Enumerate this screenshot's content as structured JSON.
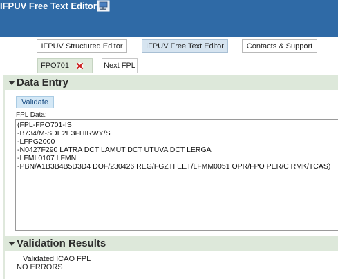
{
  "header": {
    "title": "IFPUV Free Text Editor",
    "icon": "monitor-icon",
    "background": "#2f6aa6"
  },
  "tabs": [
    {
      "label": "IFPUV Structured Editor",
      "active": false
    },
    {
      "label": "IFPUV Free Text Editor",
      "active": true
    },
    {
      "label": "Contacts & Support",
      "active": false
    }
  ],
  "subtabs": {
    "fpo": {
      "label": "FPO701",
      "close_icon": "close-icon"
    },
    "next": {
      "label": "Next FPL"
    }
  },
  "data_entry": {
    "title": "Data Entry",
    "validate_label": "Validate",
    "fpl_label": "FPL Data:",
    "fpl_text": "(FPL-FPO701-IS\n-B734/M-SDE2E3FHIRWY/S\n-LFPG2000\n-N0427F290 LATRA DCT LAMUT DCT UTUVA DCT LERGA\n-LFML0107 LFMN\n-PBN/A1B3B4B5D3D4 DOF/230426 REG/FGZTI EET/LFMM0051 OPR/FPO PER/C RMK/TCAS)"
  },
  "validation": {
    "title": "Validation Results",
    "label": "Validated ICAO FPL",
    "status": "NO ERRORS"
  },
  "colors": {
    "section_bg": "#dde8da",
    "accent_blue": "#d4e8f6",
    "active_tab": "#d6e4f0"
  }
}
